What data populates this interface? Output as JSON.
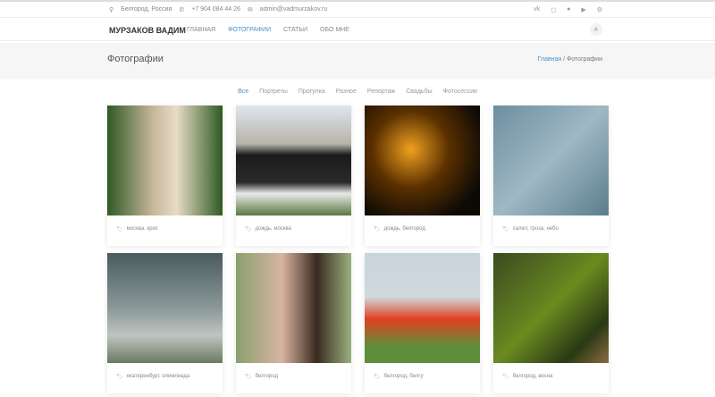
{
  "topbar": {
    "location": "Белгород, Россия",
    "phone": "+7 904 084 44 26",
    "email": "admin@vadmurzakov.ru",
    "social": [
      "vk",
      "instagram",
      "pinterest",
      "youtube",
      "other"
    ]
  },
  "nav": {
    "brand": "МУРЗАКОВ ВАДИМ",
    "items": [
      "ГЛАВНАЯ",
      "ФОТОГРАФИИ",
      "СТАТЬИ",
      "ОБО МНЕ"
    ]
  },
  "page": {
    "title": "Фотографии",
    "breadcrumb_home": "Главная",
    "breadcrumb_sep": " / ",
    "breadcrumb_current": "Фотографии"
  },
  "filters": [
    "Все",
    "Портреты",
    "Прогулка",
    "Разное",
    "Репортаж",
    "Свадьбы",
    "Фотосессии"
  ],
  "photos": [
    {
      "tags": "москва, крис"
    },
    {
      "tags": "дождь, москва"
    },
    {
      "tags": "дождь, белгород"
    },
    {
      "tags": "салют, гроза, небо"
    },
    {
      "tags": "екатеринбург, олимпиада"
    },
    {
      "tags": "белгород"
    },
    {
      "tags": "белгород, белгу"
    },
    {
      "tags": "белгород, весна"
    }
  ]
}
